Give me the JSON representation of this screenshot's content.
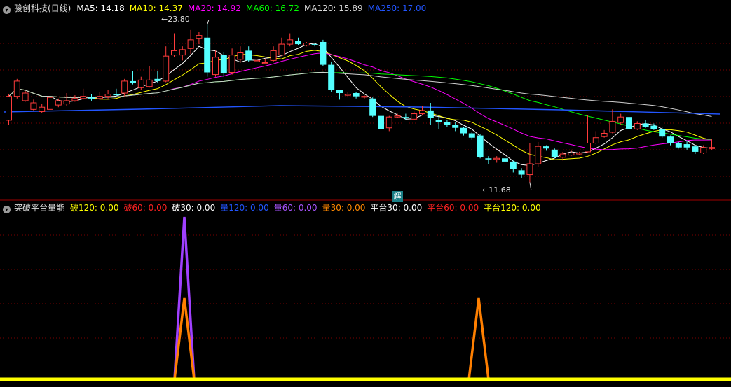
{
  "stock": {
    "name": "骏创科技(日线)"
  },
  "ma_legend": [
    {
      "key": "MA5",
      "label": "MA5: 14.18",
      "color": "#ffffff"
    },
    {
      "key": "MA10",
      "label": "MA10: 14.37",
      "color": "#ffff00"
    },
    {
      "key": "MA20",
      "label": "MA20: 14.92",
      "color": "#ff00ff"
    },
    {
      "key": "MA60",
      "label": "MA60: 16.72",
      "color": "#00ff00"
    },
    {
      "key": "MA120",
      "label": "MA120: 15.89",
      "color": "#dcdcdc"
    },
    {
      "key": "MA250",
      "label": "MA250: 17.00",
      "color": "#2255ff"
    }
  ],
  "indicator": {
    "title": "突破平台量能",
    "legend": [
      {
        "label": "破120: 0.00",
        "color": "#ffff00"
      },
      {
        "label": "破60: 0.00",
        "color": "#ff2222"
      },
      {
        "label": "破30: 0.00",
        "color": "#ffffff"
      },
      {
        "label": "量120: 0.00",
        "color": "#2255ff"
      },
      {
        "label": "量60: 0.00",
        "color": "#aa55ff"
      },
      {
        "label": "量30: 0.00",
        "color": "#ff8800"
      },
      {
        "label": "平台30: 0.00",
        "color": "#ffffff"
      },
      {
        "label": "平台60: 0.00",
        "color": "#ff2222"
      },
      {
        "label": "平台120: 0.00",
        "color": "#ffff00"
      }
    ]
  },
  "annotations": {
    "max_label": "23.80",
    "min_label": "11.68",
    "badge": "解"
  },
  "colors": {
    "up": "#ff3b3b",
    "down": "#54ffff",
    "grid": "#7a0000",
    "purple": "#a040ff",
    "orange": "#ff7f00",
    "baseline": "#ffff00"
  },
  "chart_data": {
    "type": "candlestick",
    "candles": [
      [
        15.0,
        17.2,
        17.4,
        14.6
      ],
      [
        17.2,
        18.6,
        18.8,
        17.0
      ],
      [
        16.8,
        17.5,
        17.7,
        16.7
      ],
      [
        16.0,
        16.6,
        16.9,
        15.9
      ],
      [
        15.8,
        16.2,
        16.5,
        15.7
      ],
      [
        16.0,
        17.1,
        17.6,
        15.9
      ],
      [
        16.4,
        16.8,
        17.0,
        16.2
      ],
      [
        16.5,
        16.8,
        17.5,
        16.3
      ],
      [
        16.8,
        17.0,
        17.3,
        16.7
      ],
      [
        17.0,
        17.2,
        17.9,
        16.9
      ],
      [
        17.1,
        17.0,
        17.4,
        16.8
      ],
      [
        17.0,
        17.2,
        17.6,
        16.9
      ],
      [
        17.2,
        17.4,
        17.8,
        17.0
      ],
      [
        17.4,
        17.3,
        17.9,
        17.2
      ],
      [
        17.5,
        18.6,
        18.8,
        17.2
      ],
      [
        18.6,
        18.4,
        19.5,
        18.3
      ],
      [
        18.0,
        18.7,
        19.0,
        17.8
      ],
      [
        18.1,
        18.7,
        20.0,
        18.0
      ],
      [
        18.8,
        18.6,
        19.5,
        18.4
      ],
      [
        18.6,
        20.9,
        21.8,
        18.5
      ],
      [
        21.0,
        21.4,
        23.0,
        20.8
      ],
      [
        21.0,
        21.5,
        21.8,
        20.5
      ],
      [
        21.6,
        22.4,
        23.3,
        21.1
      ],
      [
        22.5,
        22.8,
        23.1,
        22.0
      ],
      [
        22.6,
        19.4,
        23.8,
        19.0
      ],
      [
        19.2,
        20.8,
        21.4,
        19.0
      ],
      [
        21.0,
        19.3,
        21.3,
        19.0
      ],
      [
        19.4,
        21.0,
        21.6,
        19.2
      ],
      [
        20.6,
        21.2,
        21.8,
        20.3
      ],
      [
        21.4,
        20.5,
        21.8,
        20.4
      ],
      [
        20.4,
        20.5,
        20.9,
        20.2
      ],
      [
        20.3,
        20.3,
        20.6,
        20.2
      ],
      [
        20.5,
        21.4,
        21.8,
        20.4
      ],
      [
        21.0,
        22.0,
        22.6,
        20.9
      ],
      [
        22.0,
        22.4,
        23.0,
        21.8
      ],
      [
        22.3,
        22.0,
        22.6,
        21.9
      ],
      [
        21.9,
        22.1,
        22.2,
        21.8
      ],
      [
        22.0,
        21.9,
        22.1,
        21.8
      ],
      [
        22.2,
        20.1,
        22.4,
        20.0
      ],
      [
        20.1,
        17.8,
        20.4,
        17.6
      ],
      [
        17.8,
        17.5,
        17.8,
        16.9
      ],
      [
        17.3,
        17.4,
        17.6,
        17.1
      ],
      [
        17.5,
        17.2,
        17.6,
        17.0
      ],
      [
        17.2,
        17.2,
        17.3,
        17.0
      ],
      [
        17.0,
        15.4,
        17.1,
        15.3
      ],
      [
        15.4,
        14.2,
        15.5,
        14.0
      ],
      [
        14.3,
        15.3,
        15.4,
        14.0
      ],
      [
        15.3,
        15.4,
        15.6,
        15.2
      ],
      [
        15.3,
        15.2,
        15.6,
        15.0
      ],
      [
        15.1,
        15.6,
        15.8,
        15.0
      ],
      [
        15.6,
        15.9,
        16.3,
        15.5
      ],
      [
        15.9,
        15.2,
        16.6,
        14.6
      ],
      [
        15.0,
        14.8,
        15.4,
        14.2
      ],
      [
        14.8,
        14.6,
        15.0,
        14.4
      ],
      [
        14.6,
        14.3,
        14.8,
        14.0
      ],
      [
        14.3,
        13.8,
        14.4,
        13.6
      ],
      [
        13.8,
        13.4,
        13.9,
        13.2
      ],
      [
        13.6,
        11.6,
        13.7,
        11.5
      ],
      [
        11.5,
        11.4,
        11.7,
        11.0
      ],
      [
        11.4,
        11.5,
        11.7,
        11.1
      ],
      [
        11.5,
        11.2,
        11.6,
        10.7
      ],
      [
        11.2,
        10.5,
        11.3,
        10.2
      ],
      [
        10.4,
        10.0,
        10.6,
        9.7
      ],
      [
        10.0,
        11.0,
        12.9,
        9.3
      ],
      [
        11.0,
        12.6,
        13.0,
        10.7
      ],
      [
        12.6,
        12.4,
        12.7,
        12.2
      ],
      [
        12.3,
        11.6,
        12.4,
        11.5
      ],
      [
        11.6,
        11.9,
        12.1,
        11.3
      ],
      [
        11.8,
        12.0,
        12.3,
        11.7
      ],
      [
        11.9,
        12.0,
        12.1,
        11.8
      ],
      [
        12.1,
        12.9,
        15.5,
        12.0
      ],
      [
        12.9,
        13.4,
        14.0,
        12.8
      ],
      [
        13.5,
        13.8,
        14.1,
        13.4
      ],
      [
        13.9,
        14.9,
        16.0,
        13.8
      ],
      [
        14.8,
        15.3,
        15.6,
        14.6
      ],
      [
        15.3,
        14.2,
        16.3,
        14.1
      ],
      [
        14.2,
        14.7,
        14.9,
        14.1
      ],
      [
        14.7,
        14.4,
        15.0,
        14.3
      ],
      [
        14.5,
        14.2,
        14.7,
        14.1
      ],
      [
        14.2,
        13.5,
        14.4,
        13.4
      ],
      [
        13.5,
        12.9,
        13.6,
        12.7
      ],
      [
        12.9,
        12.5,
        13.0,
        12.4
      ],
      [
        12.8,
        12.5,
        13.1,
        12.3
      ],
      [
        12.6,
        12.1,
        12.7,
        11.9
      ],
      [
        12.0,
        12.5,
        12.7,
        11.9
      ],
      [
        12.4,
        12.5,
        13.3,
        12.3
      ]
    ],
    "indicator_peaks": {
      "purple": [
        {
          "index": 2,
          "value": 1.0
        }
      ],
      "orange": [
        {
          "index": 2,
          "value": 0.5
        },
        {
          "index": 7,
          "value": 0.5
        }
      ]
    }
  }
}
